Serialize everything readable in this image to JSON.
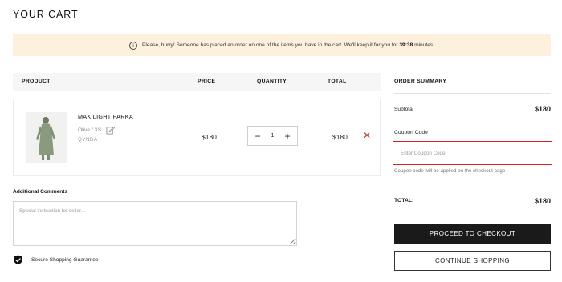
{
  "page": {
    "title": "YOUR CART"
  },
  "notice": {
    "icon": "info-circle-icon",
    "text_before": "Please, hurry! Someone has placed an order on one of the items you have in the cart. We'll keep it for you for ",
    "timer": "39:38",
    "text_after": " minutes."
  },
  "cart": {
    "headers": {
      "product": "PRODUCT",
      "price": "PRICE",
      "quantity": "QUANTITY",
      "total": "TOTAL"
    },
    "items": [
      {
        "name": "MAK LIGHT PARKA",
        "variant": "Olive / XS",
        "brand": "QYNDA",
        "price": "$180",
        "quantity": "1",
        "total": "$180",
        "remove_symbol": "✕"
      }
    ],
    "qty_minus": "−",
    "qty_plus": "+"
  },
  "comments": {
    "label": "Additional Comments",
    "placeholder": "Special instruction for seller..."
  },
  "secure": {
    "text": "Secure Shopping Guarantee",
    "icon": "shield-check-icon"
  },
  "summary": {
    "title": "ORDER SUMMARY",
    "subtotal_label": "Subtotal",
    "subtotal_value": "$180",
    "coupon_label": "Coupon Code",
    "coupon_placeholder": "Enter Coupon Code",
    "coupon_hint": "Coupon code will be applied on the checkout page",
    "total_label": "TOTAL:",
    "total_value": "$180",
    "checkout_label": "PROCEED TO CHECKOUT",
    "continue_label": "CONTINUE SHOPPING"
  },
  "colors": {
    "notice_bg": "#fdf1de",
    "remove": "#c0392b",
    "coupon_border": "#d81f26",
    "checkout_bg": "#1a1a1a",
    "product_olive": "#8a9a7e"
  }
}
